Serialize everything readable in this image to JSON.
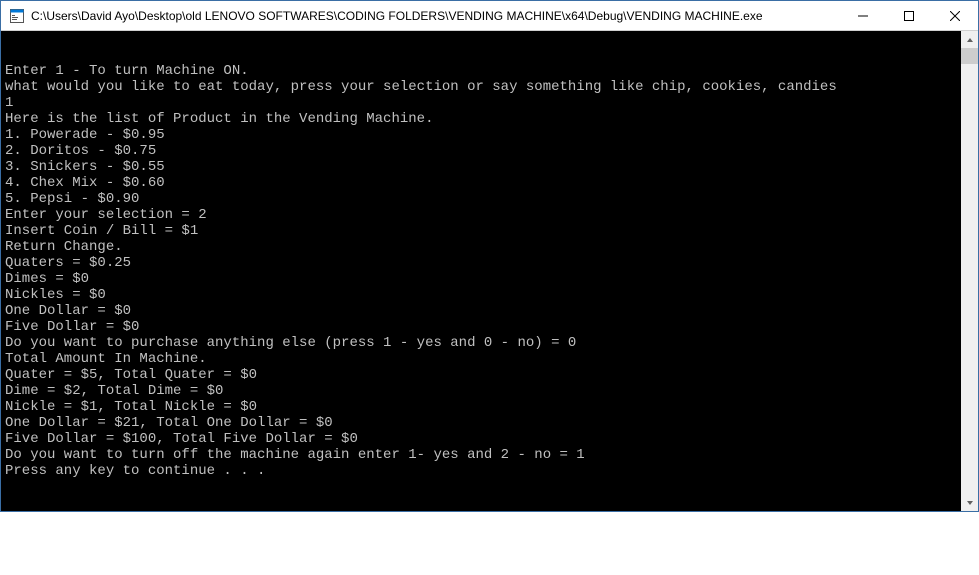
{
  "window": {
    "title": "C:\\Users\\David Ayo\\Desktop\\old LENOVO SOFTWARES\\CODING FOLDERS\\VENDING MACHINE\\x64\\Debug\\VENDING MACHINE.exe"
  },
  "console": {
    "lines": [
      "Enter 1 - To turn Machine ON.",
      "what would you like to eat today, press your selection or say something like chip, cookies, candies",
      "1",
      "Here is the list of Product in the Vending Machine.",
      "1. Powerade - $0.95",
      "2. Doritos - $0.75",
      "3. Snickers - $0.55",
      "4. Chex Mix - $0.60",
      "5. Pepsi - $0.90",
      "Enter your selection = 2",
      "Insert Coin / Bill = $1",
      "",
      "Return Change.",
      "Quaters = $0.25",
      "Dimes = $0",
      "Nickles = $0",
      "One Dollar = $0",
      "Five Dollar = $0",
      "",
      "Do you want to purchase anything else (press 1 - yes and 0 - no) = 0",
      "",
      "Total Amount In Machine.",
      "Quater = $5, Total Quater = $0",
      "Dime = $2, Total Dime = $0",
      "Nickle = $1, Total Nickle = $0",
      "One Dollar = $21, Total One Dollar = $0",
      "Five Dollar = $100, Total Five Dollar = $0",
      "",
      "Do you want to turn off the machine again enter 1- yes and 2 - no = 1",
      "Press any key to continue . . ."
    ]
  }
}
